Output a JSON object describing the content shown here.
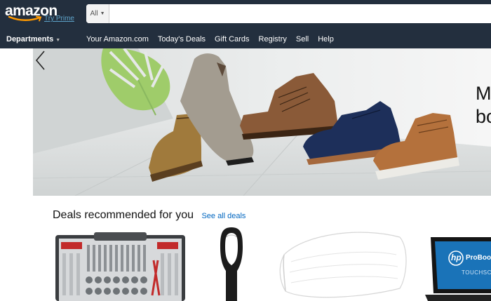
{
  "header": {
    "logo_text": "amazon",
    "logo_subtext": "Try Prime",
    "search_scope": "All",
    "search_placeholder": "",
    "departments_label": "Departments",
    "nav_links": [
      "Your Amazon.com",
      "Today's Deals",
      "Gift Cards",
      "Registry",
      "Sell",
      "Help"
    ]
  },
  "hero": {
    "line1": "M",
    "line2": "bo"
  },
  "deals": {
    "title": "Deals recommended for you",
    "see_all": "See all deals",
    "items": [
      {
        "name": "tool set",
        "icon": "toolset-image"
      },
      {
        "name": "fan",
        "icon": "fan-image"
      },
      {
        "name": "mattress pad",
        "icon": "mattress-pad-image"
      },
      {
        "name": "laptop",
        "icon": "laptop-image",
        "brand": "hp",
        "model": "ProBoo",
        "feature": "TOUCHSC"
      }
    ]
  },
  "colors": {
    "nav_bg": "#232f3e",
    "accent": "#ff9900",
    "link": "#0066c0"
  }
}
